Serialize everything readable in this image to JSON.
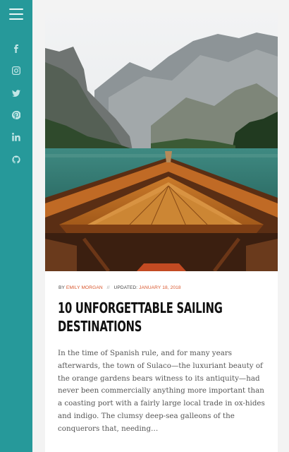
{
  "sidebar": {
    "menu_icon": "hamburger-icon",
    "social_icons": [
      "facebook-icon",
      "instagram-icon",
      "twitter-icon",
      "pinterest-icon",
      "linkedin-icon",
      "github-icon"
    ],
    "colors": {
      "background": "#26999a",
      "icon": "#c2e6e6"
    }
  },
  "post": {
    "meta": {
      "by_label": "BY",
      "author": "EMILY MORGAN",
      "separator": "//",
      "updated_label": "UPDATED:",
      "date": "JANUARY 18, 2018"
    },
    "title": "10 UNFORGETTABLE SAILING DESTINATIONS",
    "excerpt": "In the time of Spanish rule, and for many years afterwards, the town of Sulaco—the luxuriant beauty of the orange gardens bears witness to its antiquity—had never been commercially anything more important than a coasting port with a fairly large local trade in ox-hides and indigo. The clumsy deep-sea galleons of the conquerors that, needing…",
    "accent_color": "#d9562c"
  }
}
